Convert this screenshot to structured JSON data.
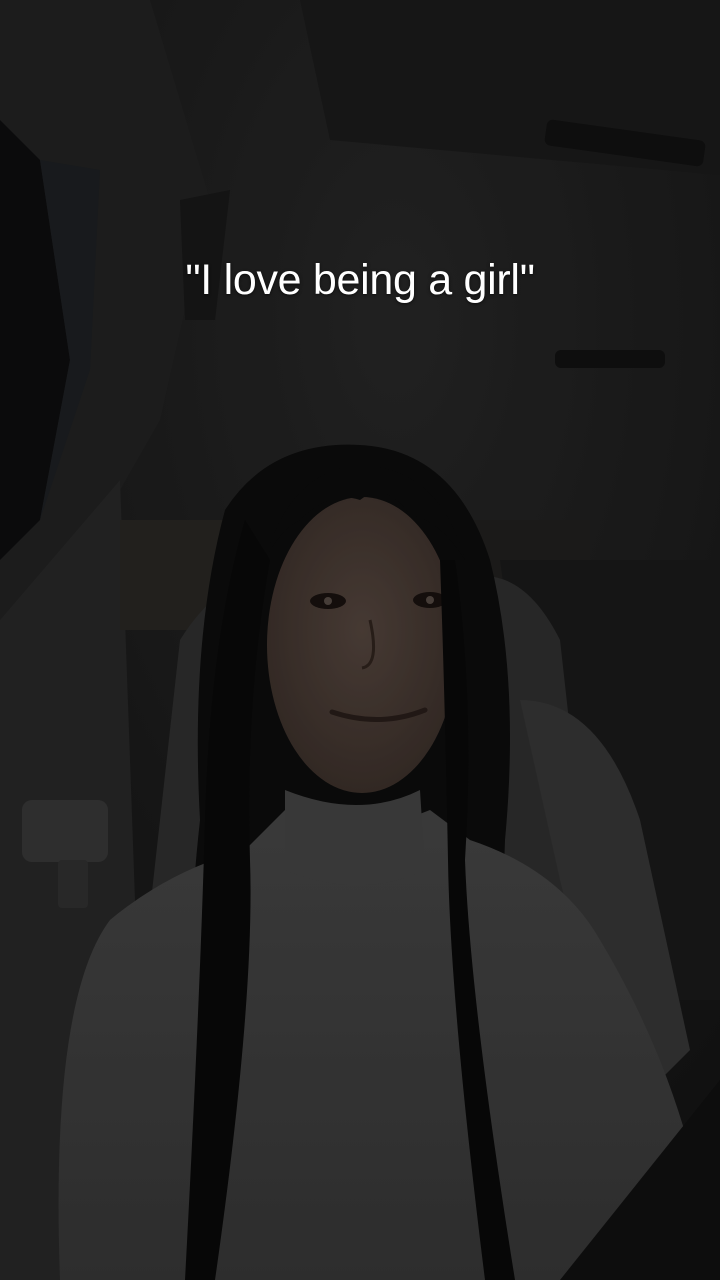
{
  "video": {
    "caption_text": "\"I love being a girl\""
  },
  "colors": {
    "overlay_dim": "#000000",
    "caption": "#ffffff"
  }
}
